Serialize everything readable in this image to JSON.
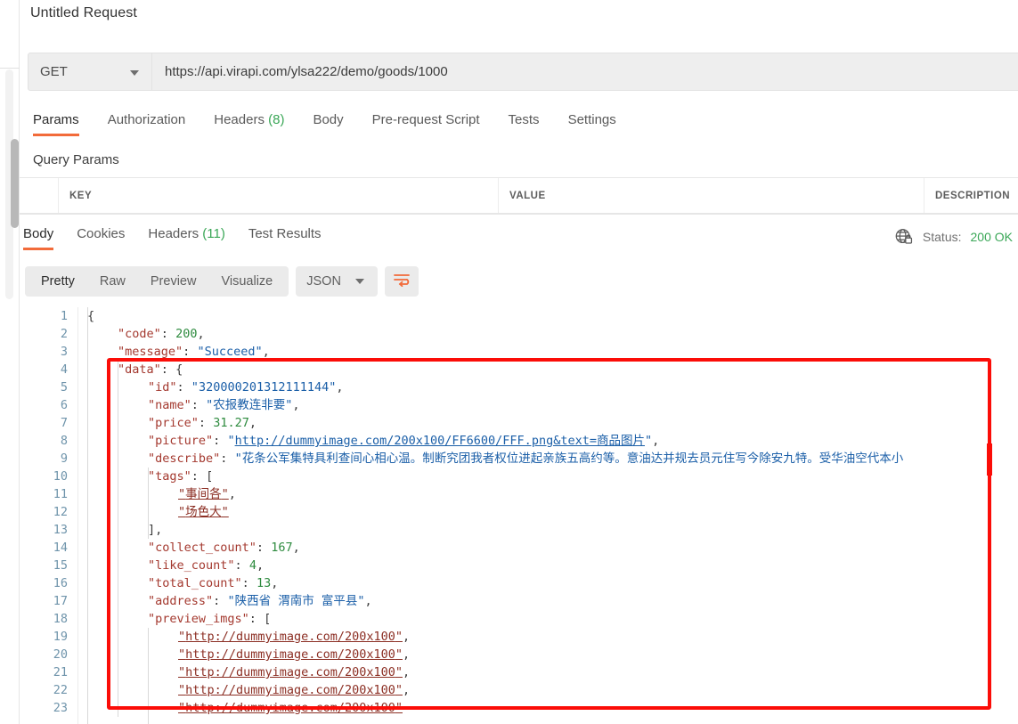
{
  "request": {
    "title": "Untitled Request",
    "method": "GET",
    "url": "https://api.virapi.com/ylsa222/demo/goods/1000",
    "tabs": [
      {
        "label": "Params",
        "count": "",
        "active": true
      },
      {
        "label": "Authorization",
        "count": "",
        "active": false
      },
      {
        "label": "Headers",
        "count": "(8)",
        "active": false
      },
      {
        "label": "Body",
        "count": "",
        "active": false
      },
      {
        "label": "Pre-request Script",
        "count": "",
        "active": false
      },
      {
        "label": "Tests",
        "count": "",
        "active": false
      },
      {
        "label": "Settings",
        "count": "",
        "active": false
      }
    ],
    "query_params_label": "Query Params",
    "table_headers": {
      "key": "KEY",
      "value": "VALUE",
      "description": "DESCRIPTION"
    }
  },
  "response": {
    "tabs": [
      {
        "label": "Body",
        "count": "",
        "active": true
      },
      {
        "label": "Cookies",
        "count": "",
        "active": false
      },
      {
        "label": "Headers",
        "count": "(11)",
        "active": false
      },
      {
        "label": "Test Results",
        "count": "",
        "active": false
      }
    ],
    "status_label": "Status:",
    "status_value": "200 OK",
    "status_icon": "globe-lock-icon",
    "format_tabs": [
      {
        "label": "Pretty",
        "active": true
      },
      {
        "label": "Raw",
        "active": false
      },
      {
        "label": "Preview",
        "active": false
      },
      {
        "label": "Visualize",
        "active": false
      }
    ],
    "format_select": "JSON",
    "wrap_icon": "wrap-lines-icon"
  },
  "code": {
    "line_numbers": [
      "1",
      "2",
      "3",
      "4",
      "5",
      "6",
      "7",
      "8",
      "9",
      "10",
      "11",
      "12",
      "13",
      "14",
      "15",
      "16",
      "17",
      "18",
      "19",
      "20",
      "21",
      "22",
      "23"
    ],
    "body": {
      "code": "200",
      "message": "Succeed",
      "data": {
        "id": "320000201312111144",
        "name": "农报教连非要",
        "price": "31.27",
        "picture": "http://dummyimage.com/200x100/FF6600/FFF.png&text=商品图片",
        "describe": "花条公军集特具利查间心相心温。制断究团我者权位进起亲族五高约等。意油达并规去员元住写今除安九特。受华油空代本小",
        "tags": [
          "事间各",
          "场色大"
        ],
        "collect_count": "167",
        "like_count": "4",
        "total_count": "13",
        "address": "陕西省 渭南市 富平县",
        "preview_imgs": [
          "http://dummyimage.com/200x100",
          "http://dummyimage.com/200x100",
          "http://dummyimage.com/200x100",
          "http://dummyimage.com/200x100",
          "http://dummyimage.com/200x100"
        ]
      }
    },
    "tokens": {
      "brace_open": "{",
      "brace_close": "}",
      "bracket_open": "[",
      "bracket_close": "]",
      "colon": ":",
      "comma": ",",
      "quote": "\"",
      "k_code": "\"code\"",
      "k_message": "\"message\"",
      "k_data": "\"data\"",
      "k_id": "\"id\"",
      "k_name": "\"name\"",
      "k_price": "\"price\"",
      "k_picture": "\"picture\"",
      "k_describe": "\"describe\"",
      "k_tags": "\"tags\"",
      "k_collect": "\"collect_count\"",
      "k_like": "\"like_count\"",
      "k_total": "\"total_count\"",
      "k_address": "\"address\"",
      "k_preview": "\"preview_imgs\""
    }
  },
  "annotation": {
    "shape": "red-rectangle-highlight",
    "color": "#fb0d08"
  },
  "colors": {
    "accent": "#f26b3a",
    "status_green": "#3aa757",
    "key": "#a4392f",
    "string": "#1b5fa8",
    "number": "#2e8b3f",
    "array_string": "#8c2f24",
    "line_number": "#6f94ab"
  }
}
